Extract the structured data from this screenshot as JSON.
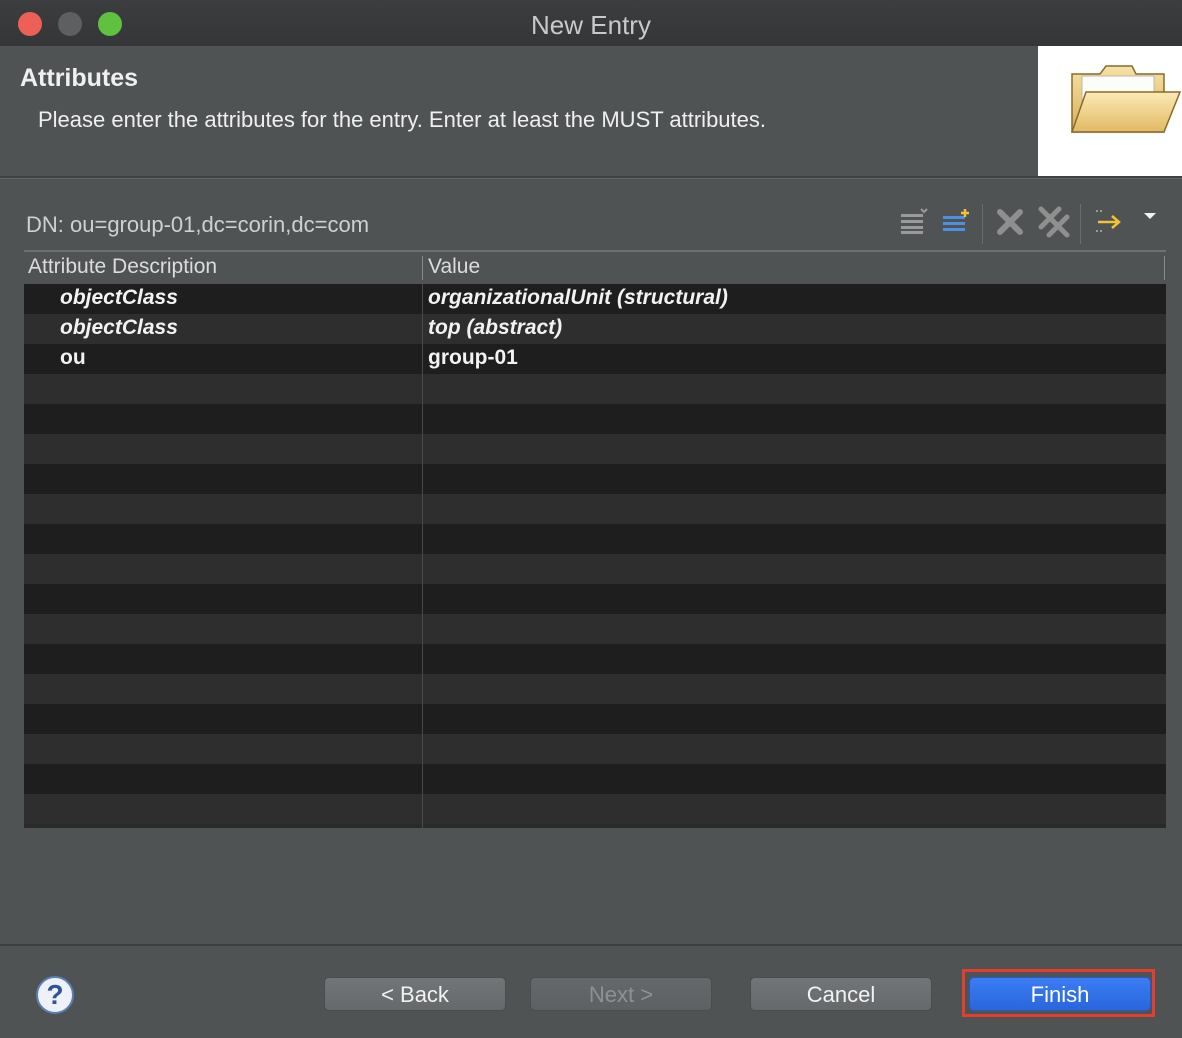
{
  "window": {
    "title": "New Entry"
  },
  "header": {
    "title": "Attributes",
    "description": "Please enter the attributes for the entry. Enter at least the MUST attributes.",
    "image_icon": "folder-icon"
  },
  "editor": {
    "dn_label": "DN: ou=group-01,dc=corin,dc=com",
    "toolbar": {
      "buttons": [
        {
          "name": "new-value-button",
          "icon": "new-value-icon"
        },
        {
          "name": "new-attribute-button",
          "icon": "new-attribute-icon"
        },
        {
          "name": "delete-button",
          "icon": "delete-icon"
        },
        {
          "name": "delete-all-button",
          "icon": "delete-all-icon"
        },
        {
          "name": "open-editor-button",
          "icon": "arrow-right-icon"
        },
        {
          "name": "view-menu-button",
          "icon": "dropdown-triangle-icon"
        }
      ]
    },
    "table": {
      "columns": [
        "Attribute Description",
        "Value"
      ],
      "rows": [
        {
          "attribute": "objectClass",
          "value": "organizationalUnit (structural)",
          "italic": true
        },
        {
          "attribute": "objectClass",
          "value": "top (abstract)",
          "italic": true
        },
        {
          "attribute": "ou",
          "value": "group-01",
          "italic": false
        }
      ],
      "empty_rows": 15
    }
  },
  "footer": {
    "help_label": "?",
    "back_label": "< Back",
    "next_label": "Next >",
    "cancel_label": "Cancel",
    "finish_label": "Finish",
    "highlight_color": "#e0402d"
  },
  "colors": {
    "accent": "#2a66dc",
    "background": "#505354"
  }
}
